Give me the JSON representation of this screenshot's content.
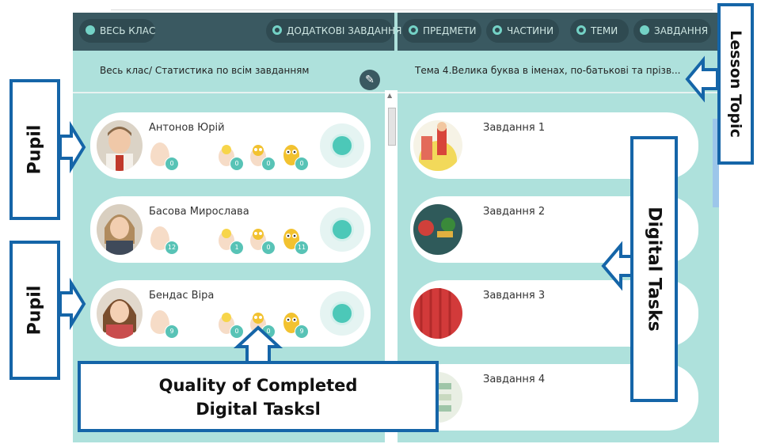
{
  "nav": {
    "left": [
      {
        "label": "ВЕСЬ КЛАС",
        "selected": true
      },
      {
        "label": "ДОДАТКОВІ ЗАВДАННЯ",
        "selected": false
      }
    ],
    "right": [
      {
        "label": "ПРЕДМЕТИ",
        "selected": false
      },
      {
        "label": "ЧАСТИНИ",
        "selected": false
      },
      {
        "label": "ТЕМИ",
        "selected": false
      },
      {
        "label": "ЗАВДАННЯ",
        "selected": true
      }
    ]
  },
  "left_header": "Весь клас/ Статистика по всім завданням",
  "right_header": "Тема 4.Велика буква в іменах, по-батькові та прізв...",
  "pupils": [
    {
      "name": "Антонов Юрій",
      "egg": "0",
      "c1": "0",
      "c2": "0",
      "c3": "0"
    },
    {
      "name": "Басова Мирослава",
      "egg": "12",
      "c1": "1",
      "c2": "0",
      "c3": "11"
    },
    {
      "name": "Бендас Віра",
      "egg": "9",
      "c1": "0",
      "c2": "0",
      "c3": "9"
    }
  ],
  "tasks": [
    {
      "label": "Завдання 1"
    },
    {
      "label": "Завдання 2"
    },
    {
      "label": "Завдання 3"
    },
    {
      "label": "Завдання 4"
    }
  ],
  "annotations": {
    "pupil1": "Pupil",
    "pupil2": "Pupil",
    "lesson_topic": "Lesson Topic",
    "digital_tasks": "Digital Tasks",
    "quality_line1": "Quality of Completed",
    "quality_line2": "Digital Tasksl"
  },
  "colors": {
    "nav_bg": "#3a5961",
    "panel_bg": "#aee1dc",
    "accent": "#4cc8b8",
    "callout_border": "#1565a8"
  }
}
